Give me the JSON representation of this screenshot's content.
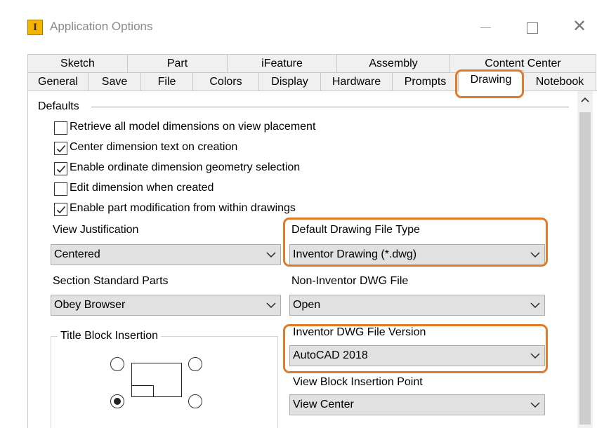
{
  "window": {
    "title": "Application Options",
    "icon_letter": "I",
    "controls": [
      "minimize-icon",
      "maximize-icon",
      "close-icon"
    ],
    "close_glyph": "✕"
  },
  "tabs": {
    "row1": [
      "Sketch",
      "Part",
      "iFeature",
      "Assembly",
      "Content Center"
    ],
    "row2": [
      "General",
      "Save",
      "File",
      "Colors",
      "Display",
      "Hardware",
      "Prompts",
      "Drawing",
      "Notebook"
    ],
    "active": "Drawing"
  },
  "defaults": {
    "section_title": "Defaults",
    "checkboxes": [
      {
        "label": "Retrieve all model dimensions on view placement",
        "checked": false
      },
      {
        "label": "Center dimension text on creation",
        "checked": true
      },
      {
        "label": "Enable ordinate dimension geometry selection",
        "checked": true
      },
      {
        "label": "Edit dimension when created",
        "checked": false
      },
      {
        "label": "Enable part modification from within drawings",
        "checked": true
      }
    ]
  },
  "fields": {
    "view_justification": {
      "label": "View Justification",
      "value": "Centered"
    },
    "default_file_type": {
      "label": "Default Drawing File Type",
      "value": "Inventor Drawing (*.dwg)"
    },
    "section_standard_parts": {
      "label": "Section Standard Parts",
      "value": "Obey Browser"
    },
    "non_inventor_dwg": {
      "label": "Non-Inventor DWG File",
      "value": "Open"
    },
    "dwg_version": {
      "label": "Inventor DWG File Version",
      "value": "AutoCAD 2018"
    },
    "view_block_insertion": {
      "label": "View Block Insertion Point",
      "value": "View Center"
    }
  },
  "title_block": {
    "label": "Title Block Insertion",
    "selected": "bottom-left"
  },
  "colors": {
    "highlight": "#e07b2a",
    "app_icon": "#f5b400"
  }
}
